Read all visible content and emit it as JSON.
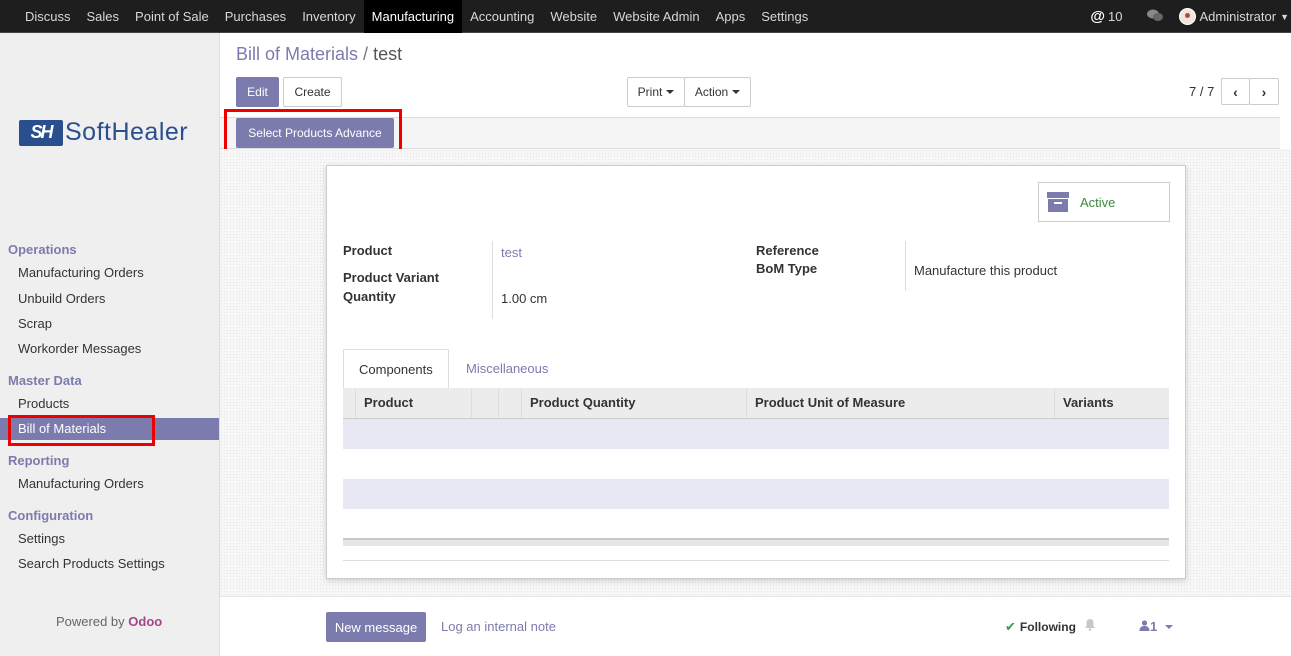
{
  "topmenu": {
    "items": [
      "Discuss",
      "Sales",
      "Point of Sale",
      "Purchases",
      "Inventory",
      "Manufacturing",
      "Accounting",
      "Website",
      "Website Admin",
      "Apps",
      "Settings"
    ],
    "active": "Manufacturing"
  },
  "systray": {
    "mention_symbol": "@",
    "mention_count": "10",
    "user_name": "Administrator"
  },
  "logo": {
    "mark": "SH",
    "text": "SoftHealer"
  },
  "sidebar": {
    "sections": [
      {
        "title": "Operations",
        "items": [
          "Manufacturing Orders",
          "Unbuild Orders",
          "Scrap",
          "Workorder Messages"
        ]
      },
      {
        "title": "Master Data",
        "items": [
          "Products",
          "Bill of Materials"
        ]
      },
      {
        "title": "Reporting",
        "items": [
          "Manufacturing Orders"
        ]
      },
      {
        "title": "Configuration",
        "items": [
          "Settings",
          "Search Products Settings"
        ]
      }
    ],
    "active_item": "Bill of Materials",
    "powered_prefix": "Powered by",
    "powered_brand": "Odoo"
  },
  "breadcrumb": {
    "parent": "Bill of Materials",
    "separator": "/",
    "current": "test"
  },
  "buttons": {
    "edit": "Edit",
    "create": "Create",
    "print": "Print",
    "action": "Action",
    "select_products_advance": "Select Products Advance"
  },
  "pager": {
    "value": "7 / 7"
  },
  "record": {
    "active_label": "Active",
    "fields_left": [
      {
        "label": "Product",
        "value": "test"
      },
      {
        "label": "Product Variant",
        "value": ""
      },
      {
        "label": "Quantity",
        "value": "1.00 cm"
      }
    ],
    "fields_right": [
      {
        "label": "Reference",
        "value": ""
      },
      {
        "label": "BoM Type",
        "value": "Manufacture this product"
      }
    ]
  },
  "tabs": [
    "Components",
    "Miscellaneous"
  ],
  "active_tab": "Components",
  "table": {
    "columns": [
      "Product",
      "Product Quantity",
      "Product Unit of Measure",
      "Variants"
    ],
    "rows": []
  },
  "chatter": {
    "new_message": "New message",
    "log_note": "Log an internal note",
    "following": "Following",
    "followers_count": "1"
  },
  "colors": {
    "accent": "#7c7bad",
    "highlight": "#e00000",
    "active_status": "#3c8b3c"
  },
  "icons": [
    "at-icon",
    "chat-bubbles-icon",
    "avatar",
    "chevron-left-icon",
    "chevron-right-icon",
    "archive-icon",
    "check-icon",
    "bell-icon",
    "user-icon"
  ]
}
